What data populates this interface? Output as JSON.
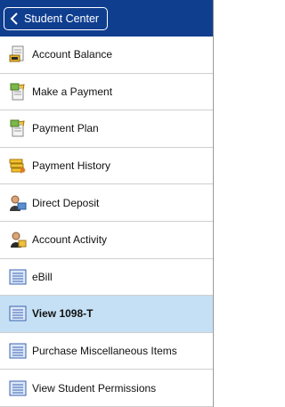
{
  "header": {
    "back_label": "Student Center",
    "back_icon": "chevron-left-icon",
    "background_color": "#0f3e8f"
  },
  "menu": {
    "active_color": "#c5e0f5",
    "items": [
      {
        "label": "Account Balance",
        "icon": "account-balance-icon"
      },
      {
        "label": "Make a Payment",
        "icon": "payment-icon"
      },
      {
        "label": "Payment Plan",
        "icon": "payment-plan-icon"
      },
      {
        "label": "Payment History",
        "icon": "payment-history-icon"
      },
      {
        "label": "Direct Deposit",
        "icon": "direct-deposit-icon"
      },
      {
        "label": "Account Activity",
        "icon": "account-activity-icon"
      },
      {
        "label": "eBill",
        "icon": "document-icon"
      },
      {
        "label": "View 1098-T",
        "icon": "document-icon",
        "selected": true
      },
      {
        "label": "Purchase Miscellaneous Items",
        "icon": "document-icon"
      },
      {
        "label": "View Student Permissions",
        "icon": "document-icon"
      }
    ]
  }
}
